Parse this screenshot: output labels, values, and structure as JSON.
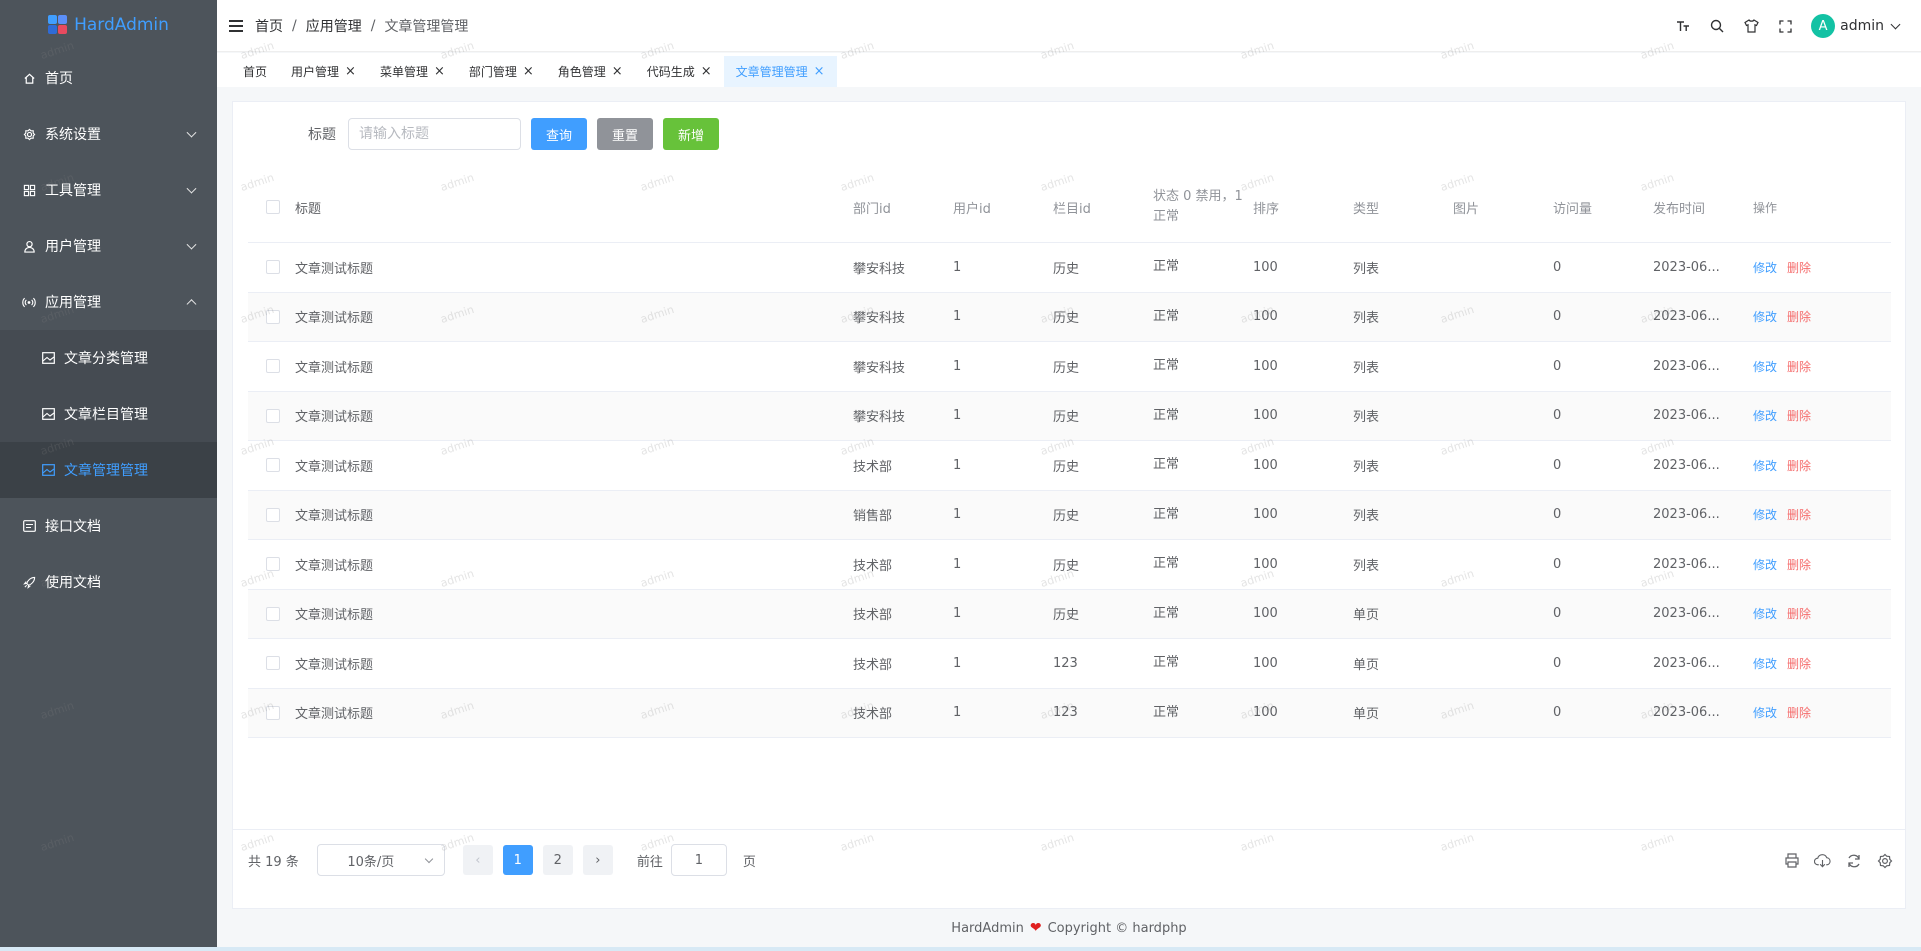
{
  "brand": {
    "name": "HardAdmin"
  },
  "sidebar": {
    "items": [
      {
        "label": "首页",
        "icon": "home-icon"
      },
      {
        "label": "系统设置",
        "icon": "gear-icon"
      },
      {
        "label": "工具管理",
        "icon": "grid-icon"
      },
      {
        "label": "用户管理",
        "icon": "user-icon"
      },
      {
        "label": "应用管理",
        "icon": "signal-icon"
      },
      {
        "label": "接口文档",
        "icon": "doc-icon"
      },
      {
        "label": "使用文档",
        "icon": "rocket-icon"
      }
    ],
    "sub_items": [
      {
        "label": "文章分类管理",
        "icon": "image-icon"
      },
      {
        "label": "文章栏目管理",
        "icon": "image-icon"
      },
      {
        "label": "文章管理管理",
        "icon": "image-icon",
        "active": true
      }
    ]
  },
  "header": {
    "breadcrumb": [
      "首页",
      "应用管理",
      "文章管理管理"
    ],
    "separator": "/",
    "user": {
      "avatar_letter": "A",
      "name": "admin"
    }
  },
  "tabs": [
    {
      "label": "首页",
      "closable": false
    },
    {
      "label": "用户管理",
      "closable": true
    },
    {
      "label": "菜单管理",
      "closable": true
    },
    {
      "label": "部门管理",
      "closable": true
    },
    {
      "label": "角色管理",
      "closable": true
    },
    {
      "label": "代码生成",
      "closable": true
    },
    {
      "label": "文章管理管理",
      "closable": true,
      "active": true
    }
  ],
  "tab_close_glyph": "×",
  "search": {
    "label": "标题",
    "placeholder": "请输入标题",
    "query_label": "查询",
    "reset_label": "重置",
    "add_label": "新增"
  },
  "table": {
    "columns": [
      "标题",
      "部门id",
      "用户id",
      "栏目id",
      "状态 0 禁用，1正常",
      "排序",
      "类型",
      "图片",
      "访问量",
      "发布时间",
      "操作"
    ],
    "edit_label": "修改",
    "delete_label": "删除",
    "rows": [
      {
        "title": "文章测试标题",
        "dept": "攀安科技",
        "user": "1",
        "column": "历史",
        "status": "正常",
        "sort": "100",
        "type": "列表",
        "image": "",
        "views": "0",
        "date": "2023-06..."
      },
      {
        "title": "文章测试标题",
        "dept": "攀安科技",
        "user": "1",
        "column": "历史",
        "status": "正常",
        "sort": "100",
        "type": "列表",
        "image": "",
        "views": "0",
        "date": "2023-06..."
      },
      {
        "title": "文章测试标题",
        "dept": "攀安科技",
        "user": "1",
        "column": "历史",
        "status": "正常",
        "sort": "100",
        "type": "列表",
        "image": "",
        "views": "0",
        "date": "2023-06..."
      },
      {
        "title": "文章测试标题",
        "dept": "攀安科技",
        "user": "1",
        "column": "历史",
        "status": "正常",
        "sort": "100",
        "type": "列表",
        "image": "",
        "views": "0",
        "date": "2023-06..."
      },
      {
        "title": "文章测试标题",
        "dept": "技术部",
        "user": "1",
        "column": "历史",
        "status": "正常",
        "sort": "100",
        "type": "列表",
        "image": "",
        "views": "0",
        "date": "2023-06..."
      },
      {
        "title": "文章测试标题",
        "dept": "销售部",
        "user": "1",
        "column": "历史",
        "status": "正常",
        "sort": "100",
        "type": "列表",
        "image": "",
        "views": "0",
        "date": "2023-06..."
      },
      {
        "title": "文章测试标题",
        "dept": "技术部",
        "user": "1",
        "column": "历史",
        "status": "正常",
        "sort": "100",
        "type": "列表",
        "image": "",
        "views": "0",
        "date": "2023-06..."
      },
      {
        "title": "文章测试标题",
        "dept": "技术部",
        "user": "1",
        "column": "历史",
        "status": "正常",
        "sort": "100",
        "type": "单页",
        "image": "",
        "views": "0",
        "date": "2023-06..."
      },
      {
        "title": "文章测试标题",
        "dept": "技术部",
        "user": "1",
        "column": "123",
        "status": "正常",
        "sort": "100",
        "type": "单页",
        "image": "",
        "views": "0",
        "date": "2023-06..."
      },
      {
        "title": "文章测试标题",
        "dept": "技术部",
        "user": "1",
        "column": "123",
        "status": "正常",
        "sort": "100",
        "type": "单页",
        "image": "",
        "views": "0",
        "date": "2023-06..."
      }
    ]
  },
  "pagination": {
    "total_text": "共 19 条",
    "page_size": "10条/页",
    "prev_glyph": "‹",
    "next_glyph": "›",
    "pages": [
      "1",
      "2"
    ],
    "current": "1",
    "goto_label": "前往",
    "goto_value": "1",
    "goto_suffix": "页"
  },
  "table_tools": [
    "printer-icon",
    "cloud-download-icon",
    "refresh-icon",
    "settings-icon"
  ],
  "footer": {
    "brand": "HardAdmin",
    "copyright": "Copyright © hardphp"
  },
  "watermark": {
    "text": "admin"
  },
  "colors": {
    "sidebar_bg": "#4d545b",
    "accent": "#409eff",
    "danger": "#f56c6c",
    "success": "#67c23a",
    "avatar": "#13c2a4"
  }
}
